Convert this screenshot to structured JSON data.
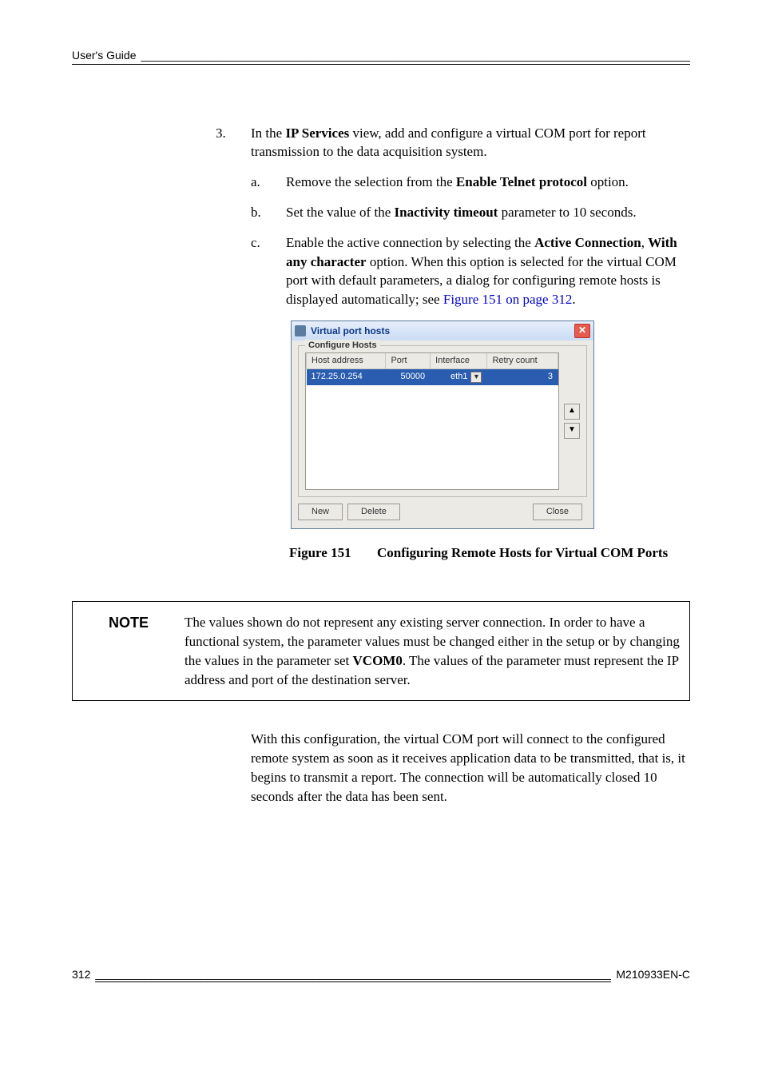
{
  "header": {
    "title": "User's Guide"
  },
  "list": {
    "num3": "3.",
    "text3_a": "In the ",
    "text3_b": "IP Services",
    "text3_c": " view, add and configure a virtual COM port for report transmission to the data acquisition system.",
    "a": {
      "num": "a.",
      "t1": "Remove the selection from the ",
      "bold": "Enable Telnet protocol",
      "t3": " option."
    },
    "b": {
      "num": "b.",
      "t1": "Set the value of the ",
      "bold": "Inactivity timeout",
      "t3": " parameter to 10 seconds."
    },
    "c": {
      "num": "c.",
      "t1": "Enable the active connection by selecting the ",
      "bold1": "Active Connection",
      "t2": ", ",
      "bold2": "With any character",
      "t3": " option. When this option is selected for the virtual COM port with default parameters, a dialog for configuring remote hosts is displayed automatically; see ",
      "link": "Figure 151 on page 312",
      "t4": "."
    }
  },
  "dialog": {
    "title": "Virtual port hosts",
    "close": "✕",
    "group_label": "Configure Hosts",
    "cols": {
      "host": "Host address",
      "port": "Port",
      "iface": "Interface",
      "retry": "Retry count"
    },
    "row": {
      "host": "172.25.0.254",
      "port": "50000",
      "iface": "eth1",
      "retry": "3"
    },
    "dropdown_glyph": "▼",
    "spin_up": "▲",
    "spin_down": "▼",
    "btn_new": "New",
    "btn_delete": "Delete",
    "btn_close": "Close"
  },
  "figure": {
    "num": "Figure 151",
    "text": "Configuring Remote Hosts for Virtual COM Ports"
  },
  "note": {
    "heading": "NOTE",
    "t1": "The values shown do not represent any existing server connection. In order to have a functional system, the parameter values must be changed either in the setup or by changing the values in the parameter set ",
    "bold": "VCOM0",
    "t2": ". The values of the parameter must represent the IP address and port of the destination server."
  },
  "after_note": "With this configuration, the virtual COM port will connect to the configured remote system as soon as it receives application data to be transmitted, that is, it begins to transmit a report. The connection will be automatically closed 10 seconds after the data has been sent.",
  "footer": {
    "page": "312",
    "docid": "M210933EN-C"
  }
}
